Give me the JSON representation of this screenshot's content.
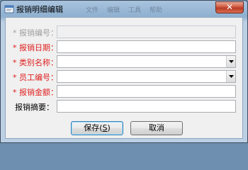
{
  "window": {
    "title": "报销明细编辑",
    "ghost_texts": [
      "文件",
      "编辑",
      "工具",
      "帮助"
    ],
    "close_label": "✕"
  },
  "form": {
    "fields": [
      {
        "label": "报销编号：",
        "required": true,
        "type": "text",
        "value": "",
        "disabled": true
      },
      {
        "label": "报销日期：",
        "required": true,
        "type": "text",
        "value": "",
        "disabled": false
      },
      {
        "label": "类别名称：",
        "required": true,
        "type": "select",
        "value": "",
        "disabled": false
      },
      {
        "label": "员工编号：",
        "required": true,
        "type": "select",
        "value": "",
        "disabled": false
      },
      {
        "label": "报销金额：",
        "required": true,
        "type": "text",
        "value": "",
        "disabled": false
      },
      {
        "label": "报销摘要：",
        "required": false,
        "type": "text",
        "value": "",
        "disabled": false
      }
    ],
    "required_mark": "*"
  },
  "buttons": {
    "save_label": "保存(",
    "save_mnemonic": "S",
    "save_suffix": ")",
    "cancel_label": "取消"
  },
  "colors": {
    "required": "#e02020",
    "disabled_label": "#a0a0a0",
    "titlebar": "#8fb0d0",
    "close_button": "#c8472f"
  }
}
